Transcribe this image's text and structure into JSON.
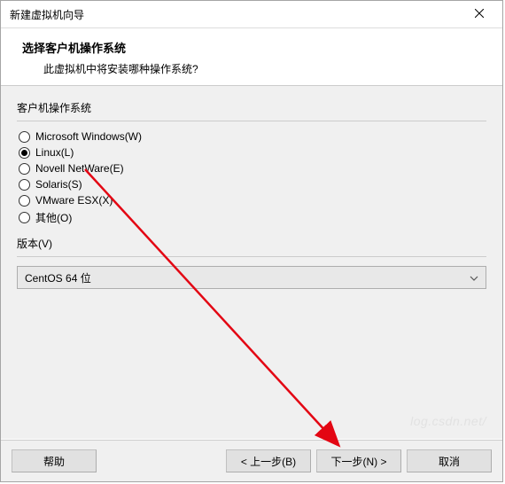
{
  "window": {
    "title": "新建虚拟机向导"
  },
  "header": {
    "title": "选择客户机操作系统",
    "subtitle": "此虚拟机中将安装哪种操作系统?"
  },
  "os_group": {
    "label": "客户机操作系统",
    "options": [
      {
        "label": "Microsoft Windows(W)",
        "selected": false
      },
      {
        "label": "Linux(L)",
        "selected": true
      },
      {
        "label": "Novell NetWare(E)",
        "selected": false
      },
      {
        "label": "Solaris(S)",
        "selected": false
      },
      {
        "label": "VMware ESX(X)",
        "selected": false
      },
      {
        "label": "其他(O)",
        "selected": false
      }
    ]
  },
  "version": {
    "label": "版本(V)",
    "selected": "CentOS 64 位"
  },
  "buttons": {
    "help": "帮助",
    "back": "< 上一步(B)",
    "next": "下一步(N) >",
    "cancel": "取消"
  },
  "watermark": "log.csdn.net/"
}
